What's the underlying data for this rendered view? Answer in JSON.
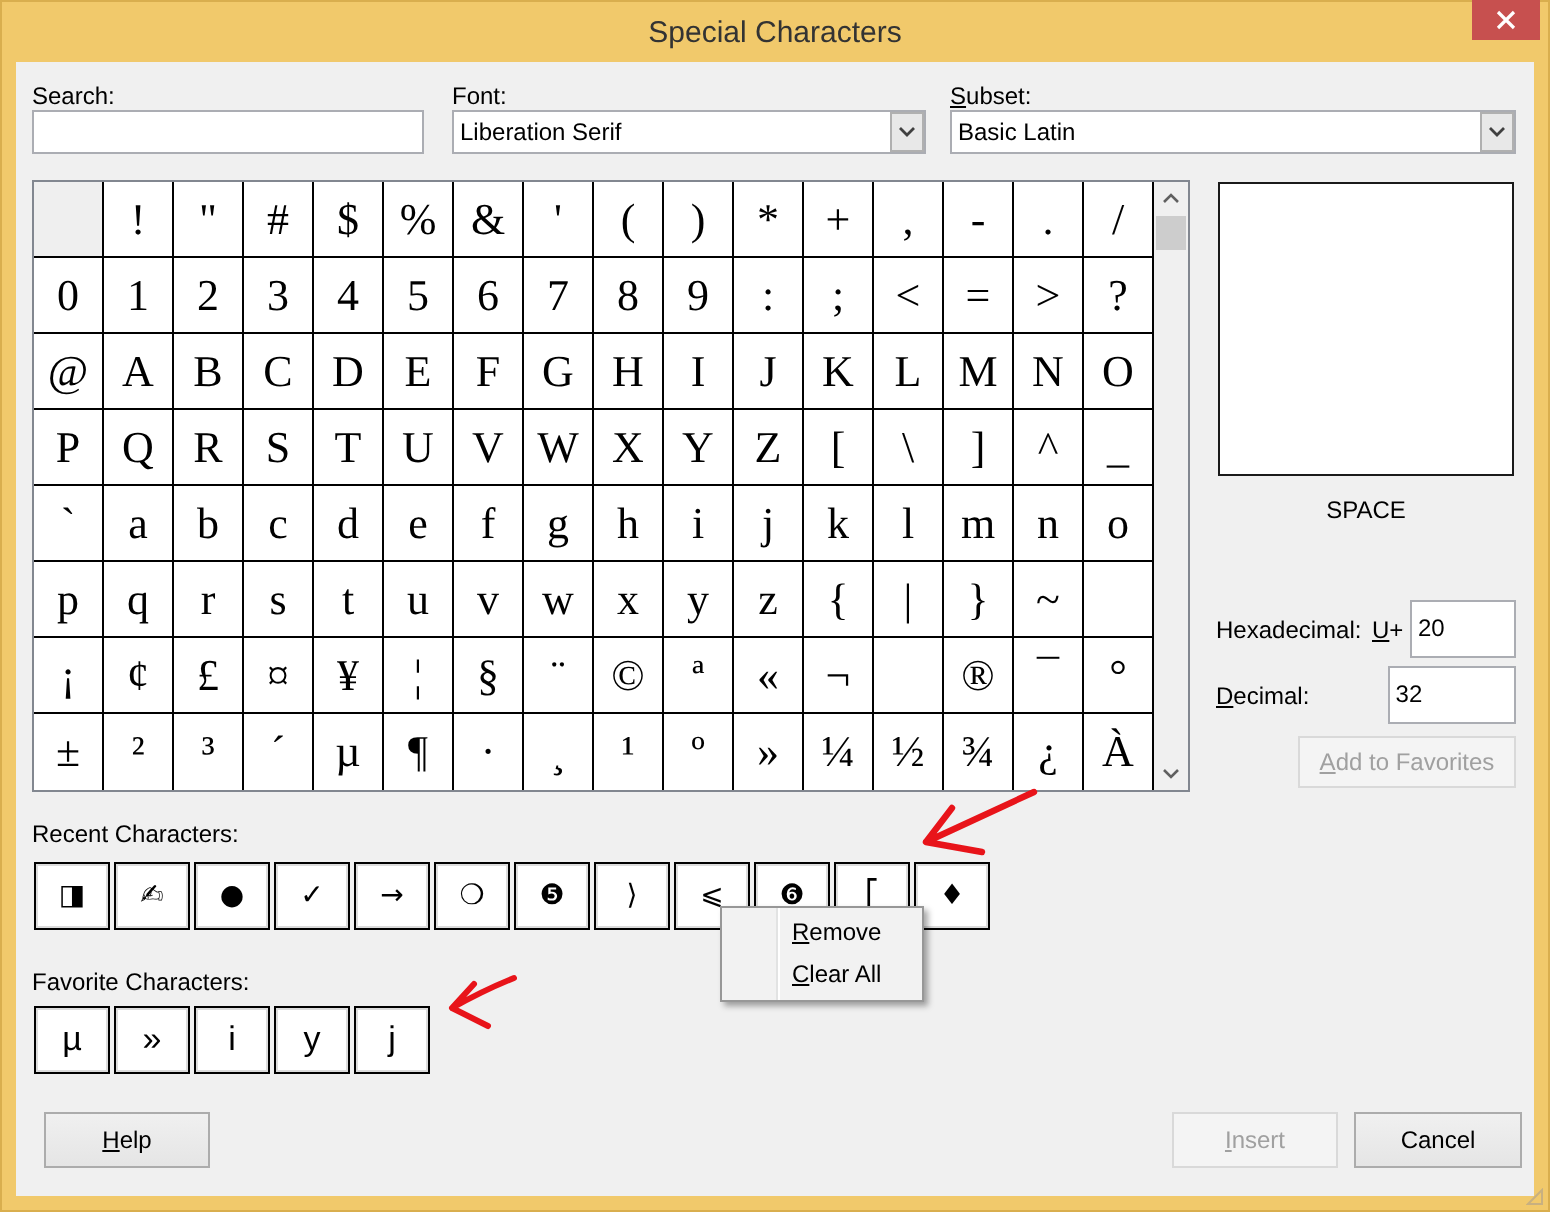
{
  "window": {
    "title": "Special Characters"
  },
  "search": {
    "label": "Search:",
    "mnemonic": false
  },
  "font": {
    "label": "Font:",
    "mnemonic": false,
    "value": "Liberation Serif"
  },
  "subset": {
    "label": "Subset:",
    "mnemonic": true,
    "value": "Basic Latin"
  },
  "character_grid": {
    "cells": [
      {
        "selected": true
      },
      {
        "char": "!",
        "selected": false
      },
      {
        "char": "\"",
        "selected": false
      },
      {
        "char": "#",
        "selected": false
      },
      {
        "char": "$",
        "selected": false
      },
      {
        "char": "%",
        "selected": false
      },
      {
        "char": "&",
        "selected": false
      },
      {
        "char": "'",
        "selected": false
      },
      {
        "char": "(",
        "selected": false
      },
      {
        "char": ")",
        "selected": false
      },
      {
        "char": "*",
        "selected": false
      },
      {
        "char": "+",
        "selected": false
      },
      {
        "char": ",",
        "selected": false
      },
      {
        "char": "-",
        "selected": false
      },
      {
        "char": ".",
        "selected": false
      },
      {
        "char": "/",
        "selected": false
      },
      {
        "char": "0",
        "selected": false
      },
      {
        "char": "1",
        "selected": false
      },
      {
        "char": "2",
        "selected": false
      },
      {
        "char": "3",
        "selected": false
      },
      {
        "char": "4",
        "selected": false
      },
      {
        "char": "5",
        "selected": false
      },
      {
        "char": "6",
        "selected": false
      },
      {
        "char": "7",
        "selected": false
      },
      {
        "char": "8",
        "selected": false
      },
      {
        "char": "9",
        "selected": false
      },
      {
        "char": ":",
        "selected": false
      },
      {
        "char": ";",
        "selected": false
      },
      {
        "char": "<",
        "selected": false
      },
      {
        "char": "=",
        "selected": false
      },
      {
        "char": ">",
        "selected": false
      },
      {
        "char": "?",
        "selected": false
      },
      {
        "char": "@",
        "selected": false
      },
      {
        "char": "A",
        "selected": false
      },
      {
        "char": "B",
        "selected": false
      },
      {
        "char": "C",
        "selected": false
      },
      {
        "char": "D",
        "selected": false
      },
      {
        "char": "E",
        "selected": false
      },
      {
        "char": "F",
        "selected": false
      },
      {
        "char": "G",
        "selected": false
      },
      {
        "char": "H",
        "selected": false
      },
      {
        "char": "I",
        "selected": false
      },
      {
        "char": "J",
        "selected": false
      },
      {
        "char": "K",
        "selected": false
      },
      {
        "char": "L",
        "selected": false
      },
      {
        "char": "M",
        "selected": false
      },
      {
        "char": "N",
        "selected": false
      },
      {
        "char": "O",
        "selected": false
      },
      {
        "char": "P",
        "selected": false
      },
      {
        "char": "Q",
        "selected": false
      },
      {
        "char": "R",
        "selected": false
      },
      {
        "char": "S",
        "selected": false
      },
      {
        "char": "T",
        "selected": false
      },
      {
        "char": "U",
        "selected": false
      },
      {
        "char": "V",
        "selected": false
      },
      {
        "char": "W",
        "selected": false
      },
      {
        "char": "X",
        "selected": false
      },
      {
        "char": "Y",
        "selected": false
      },
      {
        "char": "Z",
        "selected": false
      },
      {
        "char": "[",
        "selected": false
      },
      {
        "char": "\\",
        "selected": false
      },
      {
        "char": "]",
        "selected": false
      },
      {
        "char": "^",
        "selected": false
      },
      {
        "char": "_",
        "selected": false
      },
      {
        "char": "`",
        "selected": false
      },
      {
        "char": "a",
        "selected": false
      },
      {
        "char": "b",
        "selected": false
      },
      {
        "char": "c",
        "selected": false
      },
      {
        "char": "d",
        "selected": false
      },
      {
        "char": "e",
        "selected": false
      },
      {
        "char": "f",
        "selected": false
      },
      {
        "char": "g",
        "selected": false
      },
      {
        "char": "h",
        "selected": false
      },
      {
        "char": "i",
        "selected": false
      },
      {
        "char": "j",
        "selected": false
      },
      {
        "char": "k",
        "selected": false
      },
      {
        "char": "l",
        "selected": false
      },
      {
        "char": "m",
        "selected": false
      },
      {
        "char": "n",
        "selected": false
      },
      {
        "char": "o",
        "selected": false
      },
      {
        "char": "p",
        "selected": false
      },
      {
        "char": "q",
        "selected": false
      },
      {
        "char": "r",
        "selected": false
      },
      {
        "char": "s",
        "selected": false
      },
      {
        "char": "t",
        "selected": false
      },
      {
        "char": "u",
        "selected": false
      },
      {
        "char": "v",
        "selected": false
      },
      {
        "char": "w",
        "selected": false
      },
      {
        "char": "x",
        "selected": false
      },
      {
        "char": "y",
        "selected": false
      },
      {
        "char": "z",
        "selected": false
      },
      {
        "char": "{",
        "selected": false
      },
      {
        "char": "|",
        "selected": false
      },
      {
        "char": "}",
        "selected": false
      },
      {
        "char": "~",
        "selected": false
      },
      {
        "selected": false
      },
      {
        "char": "¡",
        "selected": false
      },
      {
        "char": "¢",
        "selected": false
      },
      {
        "char": "£",
        "selected": false
      },
      {
        "char": "¤",
        "selected": false
      },
      {
        "char": "¥",
        "selected": false
      },
      {
        "char": "¦",
        "selected": false
      },
      {
        "char": "§",
        "selected": false
      },
      {
        "char": "¨",
        "selected": false
      },
      {
        "char": "©",
        "selected": false
      },
      {
        "char": "ª",
        "selected": false
      },
      {
        "char": "«",
        "selected": false
      },
      {
        "char": "¬",
        "selected": false
      },
      {
        "selected": false
      },
      {
        "char": "®",
        "selected": false
      },
      {
        "char": "¯",
        "selected": false
      },
      {
        "char": "°",
        "selected": false
      },
      {
        "char": "±",
        "selected": false
      },
      {
        "char": "²",
        "selected": false
      },
      {
        "char": "³",
        "selected": false
      },
      {
        "char": "´",
        "selected": false
      },
      {
        "char": "µ",
        "selected": false
      },
      {
        "char": "¶",
        "selected": false
      },
      {
        "char": "·",
        "selected": false
      },
      {
        "char": "¸",
        "selected": false
      },
      {
        "char": "¹",
        "selected": false
      },
      {
        "char": "º",
        "selected": false
      },
      {
        "char": "»",
        "selected": false
      },
      {
        "char": "¼",
        "selected": false
      },
      {
        "char": "½",
        "selected": false
      },
      {
        "char": "¾",
        "selected": false
      },
      {
        "char": "¿",
        "selected": false
      },
      {
        "char": "À",
        "selected": false
      }
    ]
  },
  "preview": {
    "name": "SPACE"
  },
  "hexadecimal": {
    "label": "Hexadecimal:",
    "mnemonic": false,
    "prefix": "U+",
    "prefix_mnemonic": true,
    "value": "20"
  },
  "decimal": {
    "label": "Decimal:",
    "mnemonic": true,
    "value": "32"
  },
  "add_to_favorites": {
    "label": "Add to Favorites",
    "mnemonic": true,
    "disabled": true
  },
  "recent_characters": {
    "label": "Recent Characters:",
    "mnemonic": false,
    "items": [
      "◨",
      "✍",
      "●",
      "✓",
      "→",
      "❍",
      "❺",
      "⟩",
      "⩽",
      "❻",
      "⎡",
      "♦"
    ]
  },
  "favorite_characters": {
    "label": "Favorite Characters:",
    "mnemonic": false,
    "items": [
      "µ",
      "»",
      "i",
      "y",
      "j"
    ]
  },
  "context_menu": {
    "items": [
      {
        "label": "Remove",
        "mnemonic": true
      },
      {
        "label": "Clear All",
        "mnemonic": true
      }
    ]
  },
  "buttons": [
    {
      "label": "Help",
      "mnemonic": true,
      "disabled": false,
      "at_right": false
    },
    {
      "label": "Insert",
      "mnemonic": true,
      "disabled": true,
      "at_right": true
    },
    {
      "label": "Cancel",
      "mnemonic": false,
      "disabled": false,
      "at_right": true
    }
  ]
}
